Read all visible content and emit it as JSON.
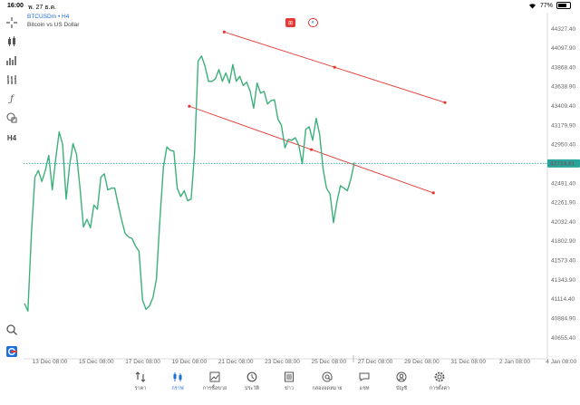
{
  "status_bar": {
    "time": "16:00",
    "date": "พ. 27 ธ.ค.",
    "battery": "77%"
  },
  "symbol": {
    "ticker": "BTCUSDm • H4",
    "description": "Bitcoin vs US Dollar"
  },
  "toolbar": {
    "timeframe": "H4"
  },
  "price_axis": [
    "44327.40",
    "44097.90",
    "43868.40",
    "43638.90",
    "43409.40",
    "43179.90",
    "42950.40",
    "42491.40",
    "42261.90",
    "42032.40",
    "41802.90",
    "41573.40",
    "41343.90",
    "41114.40",
    "40884.90",
    "40655.40"
  ],
  "current_price": "42724.81",
  "time_axis": [
    "13 Dec 08:00",
    "15 Dec 08:00",
    "17 Dec 08:00",
    "19 Dec 08:00",
    "21 Dec 08:00",
    "23 Dec 08:00",
    "25 Dec 08:00",
    "27 Dec 08:00",
    "29 Dec 08:00",
    "31 Dec 08:00",
    "2 Jan 08:00",
    "4 Jan 08:00"
  ],
  "colors": {
    "line": "#3cb07a",
    "current_price": "#26a69a",
    "trendline": "#e53935",
    "accent": "#1e6fd9"
  },
  "nav": [
    {
      "icon": "quotes-icon",
      "label": "ราคา"
    },
    {
      "icon": "chart-icon",
      "label": "กราฟ",
      "active": true
    },
    {
      "icon": "trade-icon",
      "label": "การซื้อขาย"
    },
    {
      "icon": "history-icon",
      "label": "ประวัติ"
    },
    {
      "icon": "news-icon",
      "label": "ข่าว"
    },
    {
      "icon": "mailbox-icon",
      "label": "กล่องจดหมาย"
    },
    {
      "icon": "chat-icon",
      "label": "แชท"
    },
    {
      "icon": "account-icon",
      "label": "บัญชี"
    },
    {
      "icon": "settings-icon",
      "label": "การตั้งค่า"
    }
  ],
  "chart_data": {
    "type": "line",
    "price_scale": [
      40655.4,
      44327.4
    ],
    "time_labels": [
      "13 Dec 08:00",
      "15 Dec 08:00",
      "17 Dec 08:00",
      "19 Dec 08:00",
      "21 Dec 08:00",
      "23 Dec 08:00",
      "25 Dec 08:00",
      "27 Dec 08:00",
      "29 Dec 08:00",
      "31 Dec 08:00",
      "2 Jan 08:00",
      "4 Jan 08:00"
    ],
    "bars_per_label": 12,
    "series": [
      {
        "values": [
          41060,
          40970,
          41900,
          42560,
          42640,
          42510,
          42640,
          42820,
          42410,
          42780,
          43100,
          42950,
          42300,
          42700,
          42960,
          42830,
          42430,
          41970,
          42060,
          41960,
          42230,
          42180,
          42560,
          42600,
          42410,
          42430,
          42430,
          42230,
          42050,
          41890,
          41850,
          41830,
          41740,
          41680,
          41100,
          40990,
          41030,
          41130,
          41350,
          42050,
          42680,
          42920,
          42880,
          42870,
          42430,
          42330,
          42400,
          42280,
          42300,
          42850,
          43940,
          44000,
          43880,
          43700,
          43700,
          43730,
          43840,
          43700,
          43800,
          43680,
          43900,
          43700,
          43760,
          43650,
          43690,
          43580,
          43380,
          43680,
          43560,
          43580,
          43430,
          43470,
          43480,
          43250,
          43180,
          42910,
          43010,
          43000,
          43030,
          42940,
          42720,
          43130,
          43160,
          43000,
          43260,
          43070,
          42660,
          42430,
          42360,
          42020,
          42270,
          42460,
          42430,
          42400,
          42540,
          42735
        ]
      }
    ],
    "trendlines": [
      {
        "from": {
          "time": "20 Dec 20:00",
          "price": 44287
        },
        "to": {
          "time": "30 Dec 08:00",
          "price": 43448
        }
      },
      {
        "from": {
          "time": "19 Dec 08:00",
          "price": 43404
        },
        "to": {
          "time": "29 Dec 20:00",
          "price": 42374
        }
      }
    ],
    "current_price": 42724.81
  }
}
